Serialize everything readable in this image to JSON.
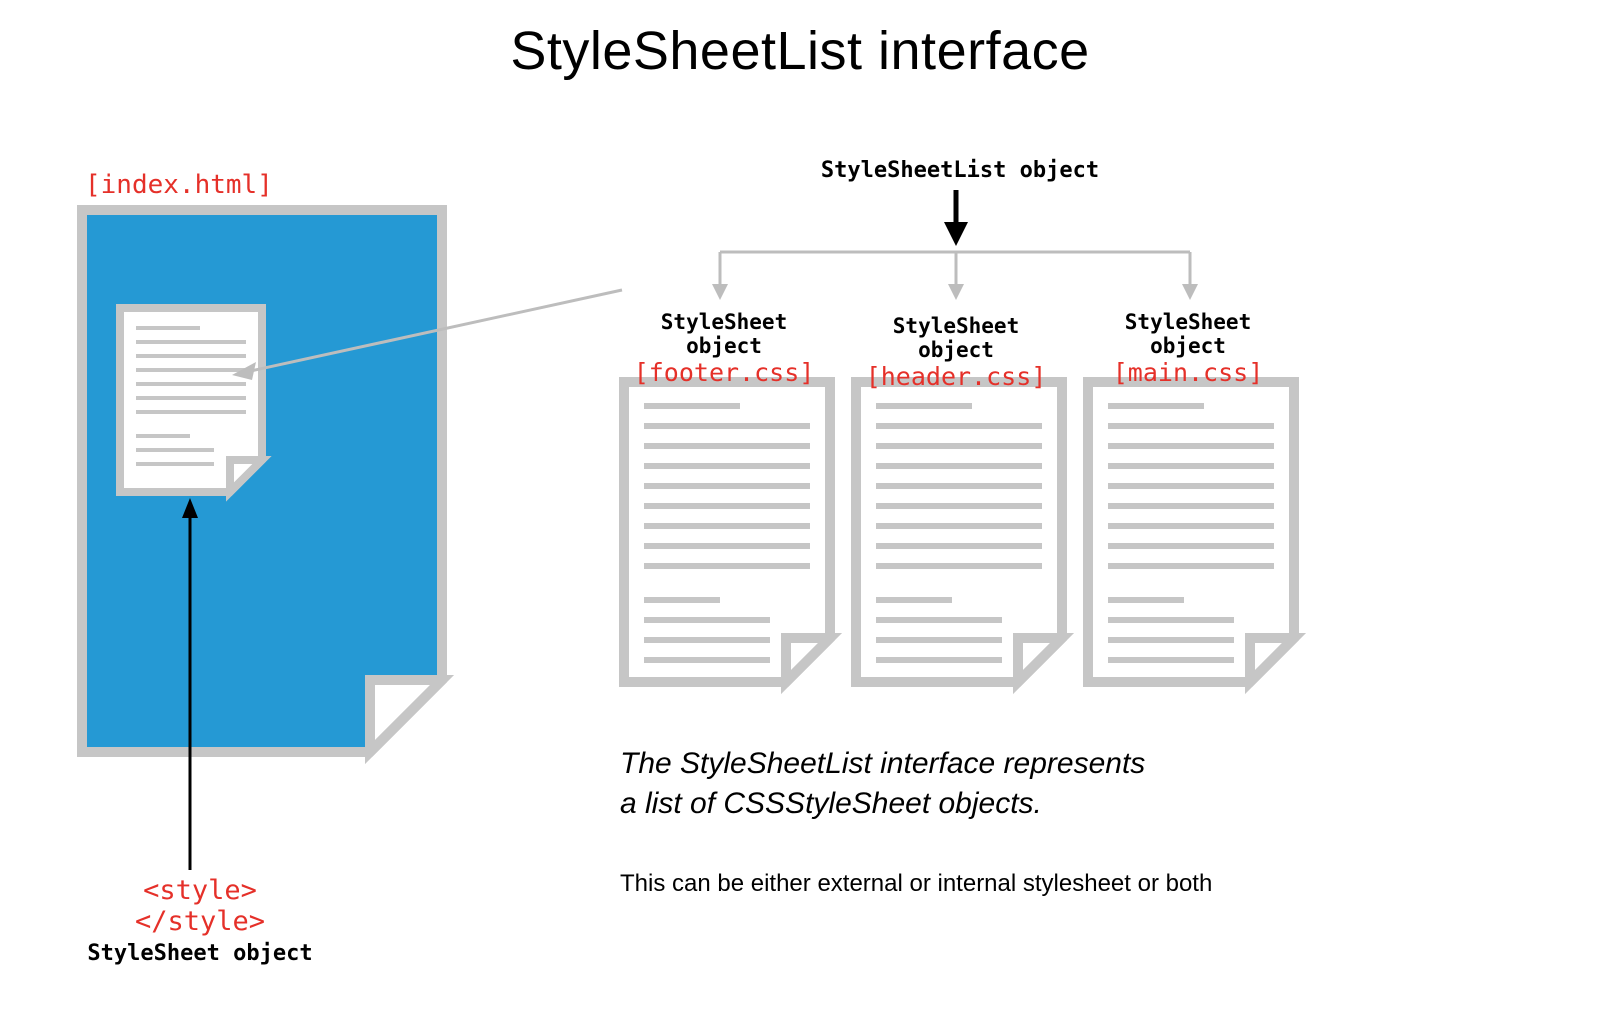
{
  "title": "StyleSheetList interface",
  "colors": {
    "red": "#e53029",
    "blue": "#2599d4",
    "grey": "#c6c6c6",
    "dark": "#000000"
  },
  "left": {
    "index_label": "[index.html]",
    "style_tag": "<style></style>",
    "stylesheet_obj": "StyleSheet object"
  },
  "top": {
    "list_obj": "StyleSheetList object"
  },
  "sheets": [
    {
      "obj": "StyleSheet object",
      "file": "[footer.css]"
    },
    {
      "obj": "StyleSheet object",
      "file": "[header.css]"
    },
    {
      "obj": "StyleSheet object",
      "file": "[main.css]"
    }
  ],
  "caption": {
    "line1": "The StyleSheetList interface represents",
    "line2": "a list of CSSStyleSheet objects.",
    "note": "This can be either external or internal stylesheet or both"
  }
}
